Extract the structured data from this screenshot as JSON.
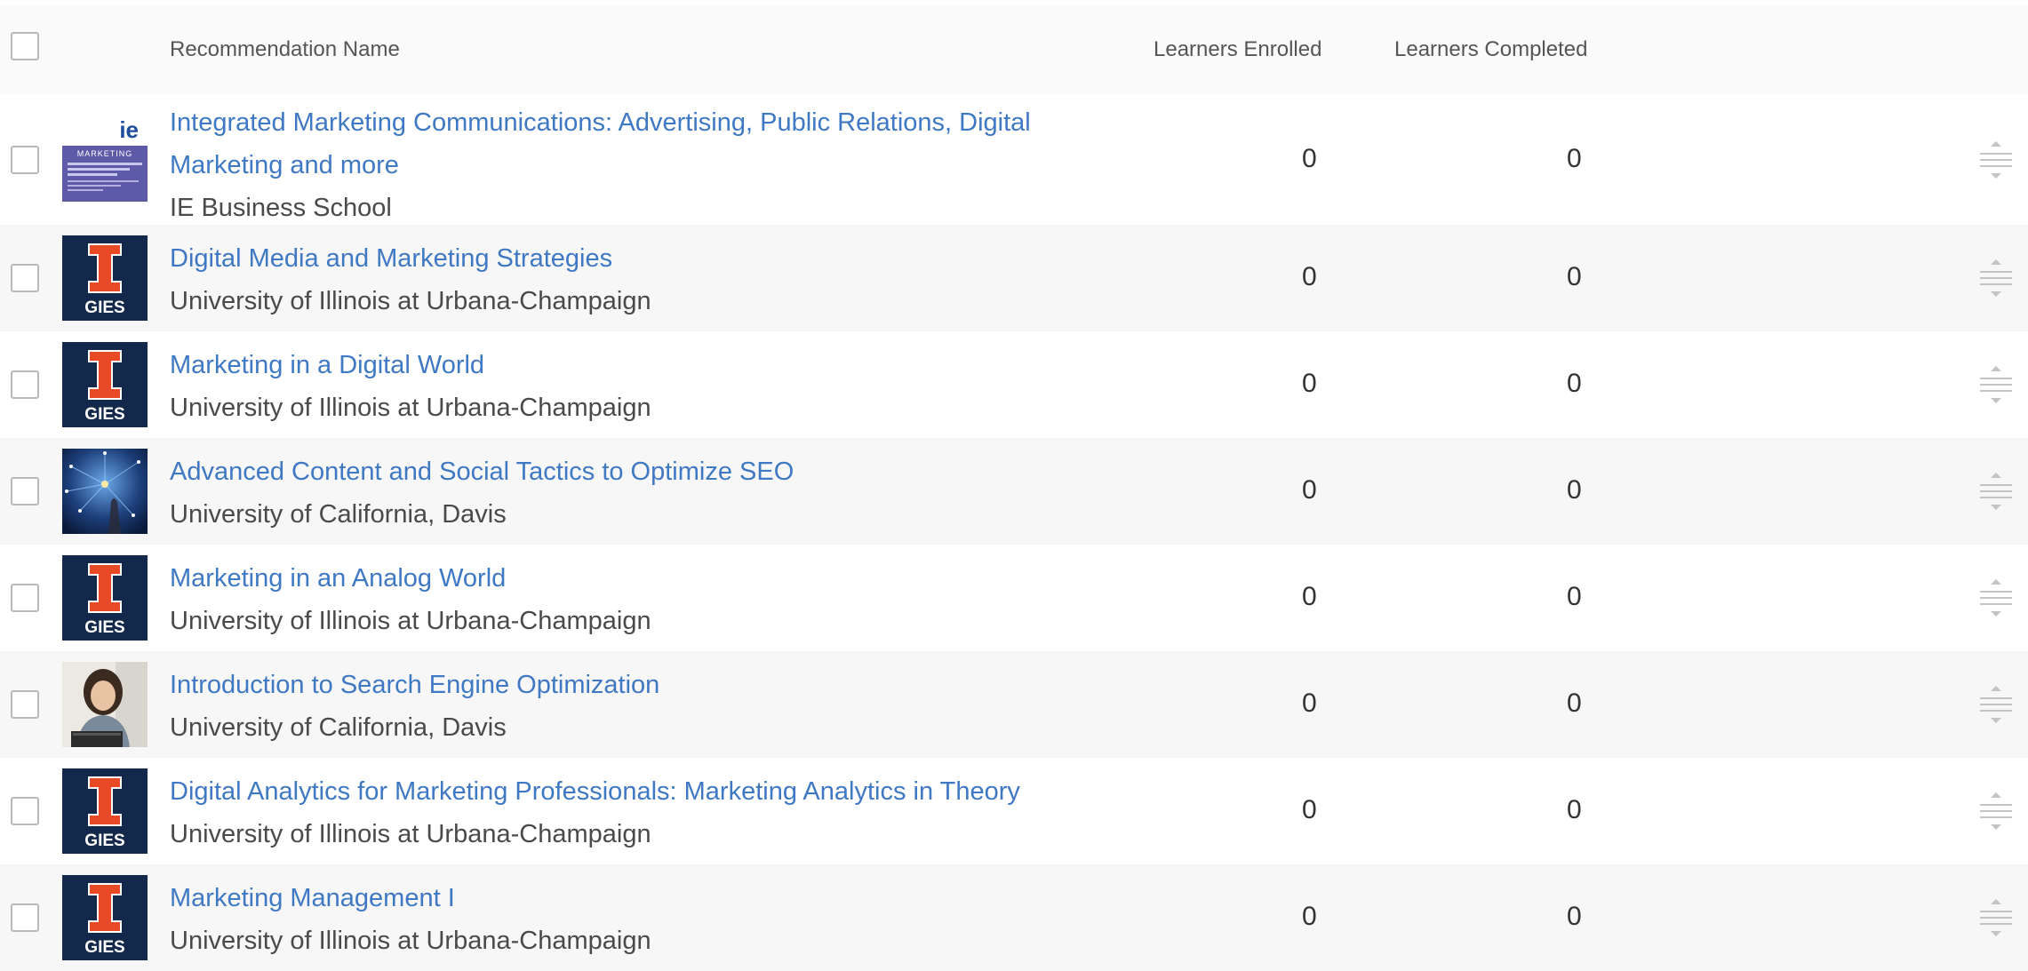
{
  "header": {
    "col_name": "Recommendation Name",
    "col_enrolled": "Learners Enrolled",
    "col_completed": "Learners Completed"
  },
  "logos": {
    "ie_text": "ie",
    "ie_marketing": "MARKETING",
    "gies_text": "GIES",
    "gies_letter": "I"
  },
  "colors": {
    "link": "#3f78c3",
    "gies_navy": "#13294b",
    "gies_orange": "#e84a27",
    "ie_purple": "#5d5aa8"
  },
  "rows": [
    {
      "title": "Integrated Marketing Communications: Advertising, Public Relations, Digital Marketing and more",
      "partner": "IE Business School",
      "enrolled": "0",
      "completed": "0",
      "thumb": "ie"
    },
    {
      "title": "Digital Media and Marketing Strategies",
      "partner": "University of Illinois at Urbana-Champaign",
      "enrolled": "0",
      "completed": "0",
      "thumb": "gies"
    },
    {
      "title": "Marketing in a Digital World",
      "partner": "University of Illinois at Urbana-Champaign",
      "enrolled": "0",
      "completed": "0",
      "thumb": "gies"
    },
    {
      "title": "Advanced Content and Social Tactics to Optimize SEO",
      "partner": "University of California, Davis",
      "enrolled": "0",
      "completed": "0",
      "thumb": "network"
    },
    {
      "title": "Marketing in an Analog World",
      "partner": "University of Illinois at Urbana-Champaign",
      "enrolled": "0",
      "completed": "0",
      "thumb": "gies"
    },
    {
      "title": "Introduction to Search Engine Optimization",
      "partner": "University of California, Davis",
      "enrolled": "0",
      "completed": "0",
      "thumb": "photo"
    },
    {
      "title": "Digital Analytics for Marketing Professionals: Marketing Analytics in Theory",
      "partner": "University of Illinois at Urbana-Champaign",
      "enrolled": "0",
      "completed": "0",
      "thumb": "gies"
    },
    {
      "title": "Marketing Management I",
      "partner": "University of Illinois at Urbana-Champaign",
      "enrolled": "0",
      "completed": "0",
      "thumb": "gies"
    }
  ]
}
